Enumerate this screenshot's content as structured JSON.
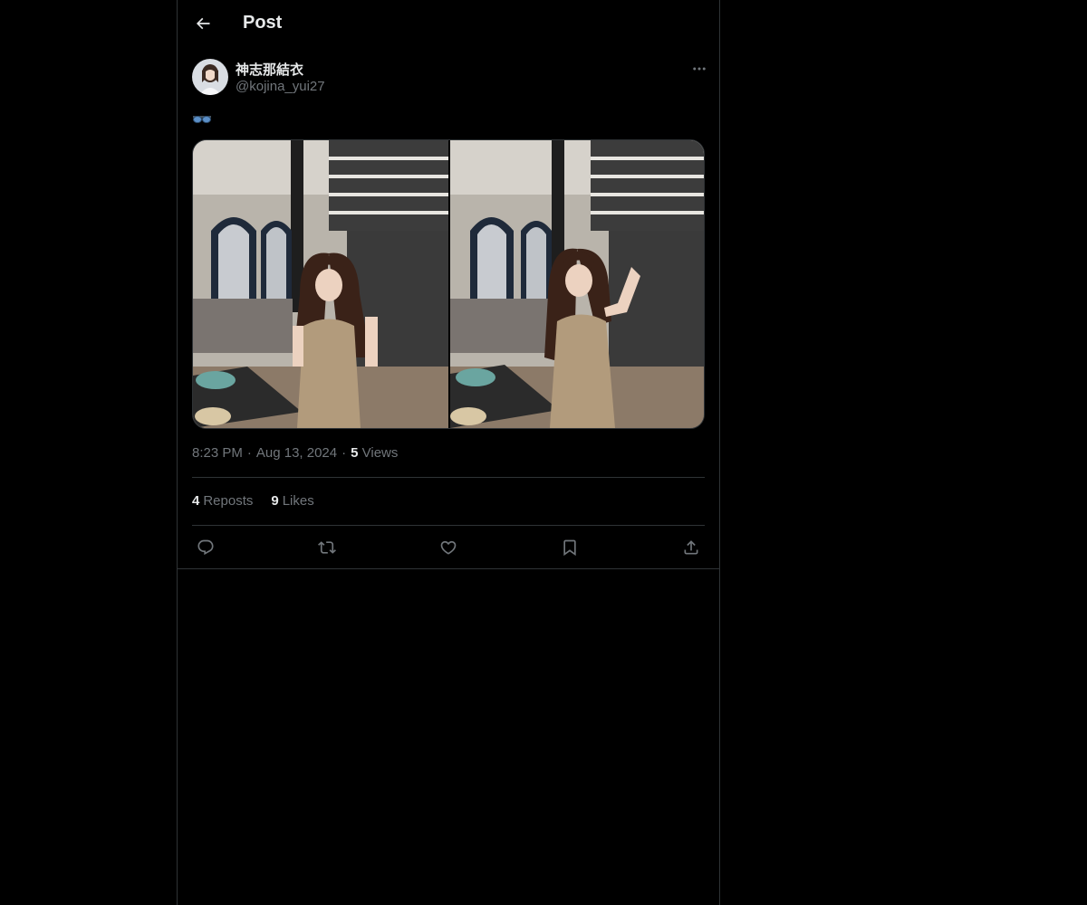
{
  "header": {
    "title": "Post",
    "back_icon": "arrow-left-icon"
  },
  "post": {
    "author": {
      "display_name": "神志那結衣",
      "handle": "@kojina_yui27",
      "avatar_icon": "avatar"
    },
    "text_emoji": "glasses-emoji",
    "media": [
      {
        "alt": "photo-1"
      },
      {
        "alt": "photo-2"
      }
    ],
    "meta": {
      "time": "8:23 PM",
      "sep": "·",
      "date": "Aug 13, 2024",
      "views_count": "5",
      "views_label": "Views"
    },
    "stats": {
      "reposts_count": "4",
      "reposts_label": "Reposts",
      "likes_count": "9",
      "likes_label": "Likes"
    }
  },
  "actions": [
    "reply-icon",
    "repost-icon",
    "like-icon",
    "bookmark-icon",
    "share-icon"
  ],
  "colors": {
    "background": "#000000",
    "border": "#2f3336",
    "text": "#e7e9ea",
    "muted": "#71767b"
  }
}
